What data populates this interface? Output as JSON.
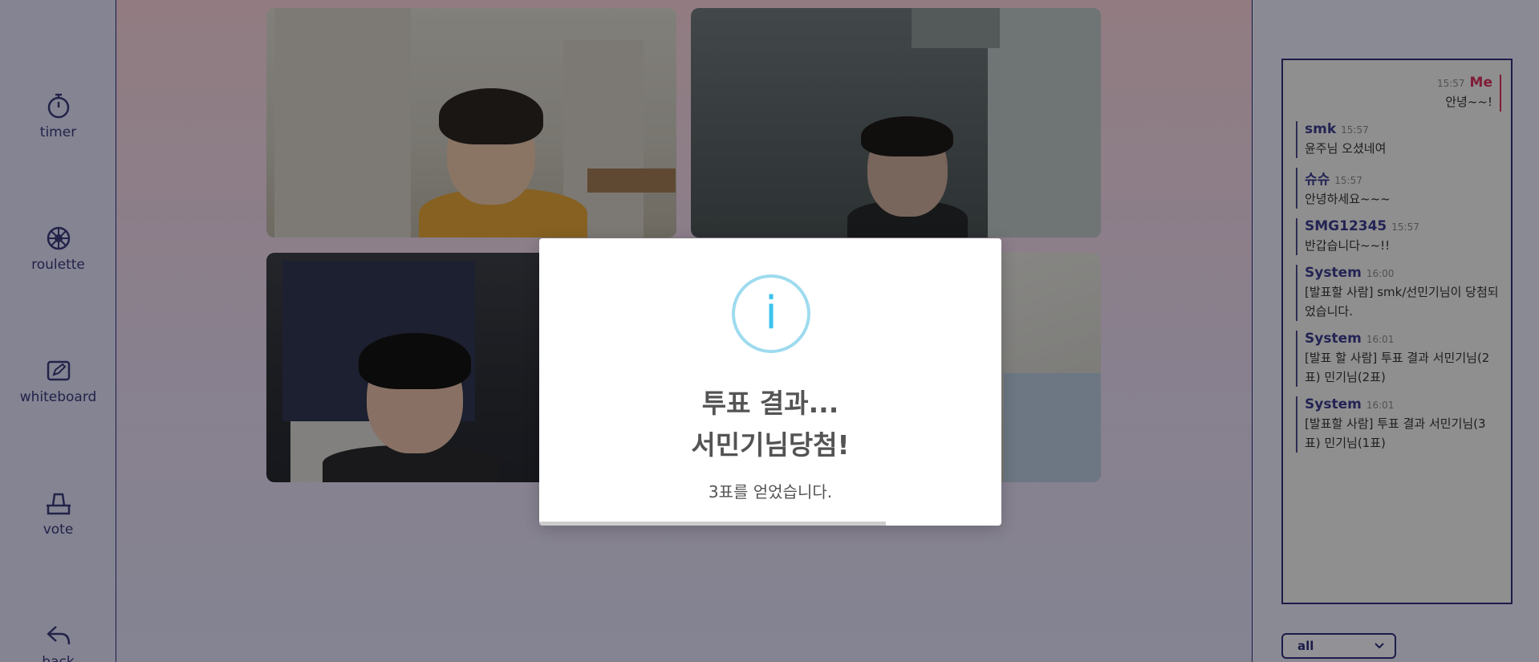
{
  "sidebar": {
    "tools": [
      {
        "label": "timer",
        "icon": "stopwatch-icon"
      },
      {
        "label": "roulette",
        "icon": "ship-wheel-icon"
      },
      {
        "label": "whiteboard",
        "icon": "edit-board-icon"
      },
      {
        "label": "vote",
        "icon": "ballot-box-icon"
      },
      {
        "label": "back",
        "icon": "back-arrow-icon"
      }
    ]
  },
  "videos": [
    {
      "id": "participant-1"
    },
    {
      "id": "participant-2"
    },
    {
      "id": "participant-3"
    },
    {
      "id": "participant-4"
    }
  ],
  "chat": {
    "messages": [
      {
        "name": "Me",
        "time": "15:57",
        "text": "안녕~~!",
        "mine": true
      },
      {
        "name": "smk",
        "time": "15:57",
        "text": "윤주님 오셨네여"
      },
      {
        "name": "슈슈",
        "time": "15:57",
        "text": "안녕하세요~~~"
      },
      {
        "name": "SMG12345",
        "time": "15:57",
        "text": "반갑습니다~~!!"
      },
      {
        "name": "System",
        "time": "16:00",
        "text": "[발표할 사람] smk/선민기님이 당첨되었습니다."
      },
      {
        "name": "System",
        "time": "16:01",
        "text": "[발표 할 사람] 투표 결과 서민기님(2표) 민기님(2표)"
      },
      {
        "name": "System",
        "time": "16:01",
        "text": "[발표할 사람] 투표 결과 서민기님(3표) 민기님(1표)"
      }
    ],
    "filter": {
      "selected": "all"
    }
  },
  "modal": {
    "icon": "info-icon",
    "icon_glyph": "i",
    "title_line1": "투표 결과...",
    "title_line2": "서민기님당첨!",
    "text": "3표를 얻었습니다.",
    "timer_progress": 0.75
  },
  "colors": {
    "accent": "#2e2e7a",
    "me": "#d62f5c",
    "info": "#3fc3ee"
  }
}
